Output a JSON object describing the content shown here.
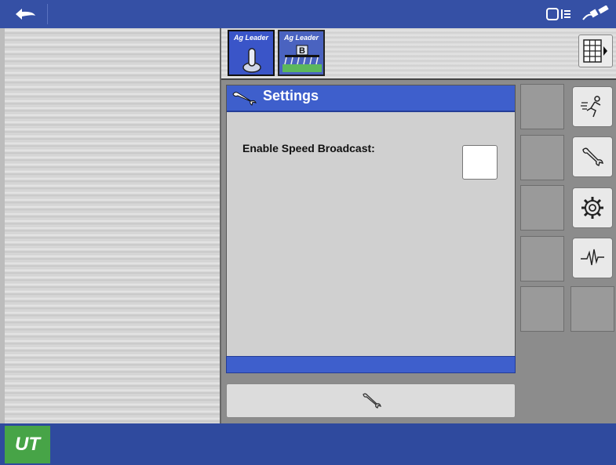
{
  "topbar": {
    "back_icon": "undo-arrow-icon",
    "status_icons": [
      "implement-status-icon",
      "gps-satellite-icon"
    ]
  },
  "tabs": [
    {
      "brand": "Ag Leader",
      "icon": "joystick-icon",
      "active": true
    },
    {
      "brand": "Ag Leader",
      "badge": "B",
      "icon": "sprayer-boom-icon",
      "active": false
    }
  ],
  "settings": {
    "title": "Settings",
    "speed_broadcast_label": "Enable Speed Broadcast:",
    "speed_broadcast_checked": false
  },
  "sidebar": {
    "buttons": [
      "run-screen-icon",
      "wrench-icon",
      "gear-icon",
      "diagnostics-icon"
    ]
  },
  "bottom": {
    "logo": "UT",
    "colors": {
      "brand_blue": "#3550a5",
      "header_blue": "#3e5fcc",
      "logo_green": "#47a447"
    }
  }
}
